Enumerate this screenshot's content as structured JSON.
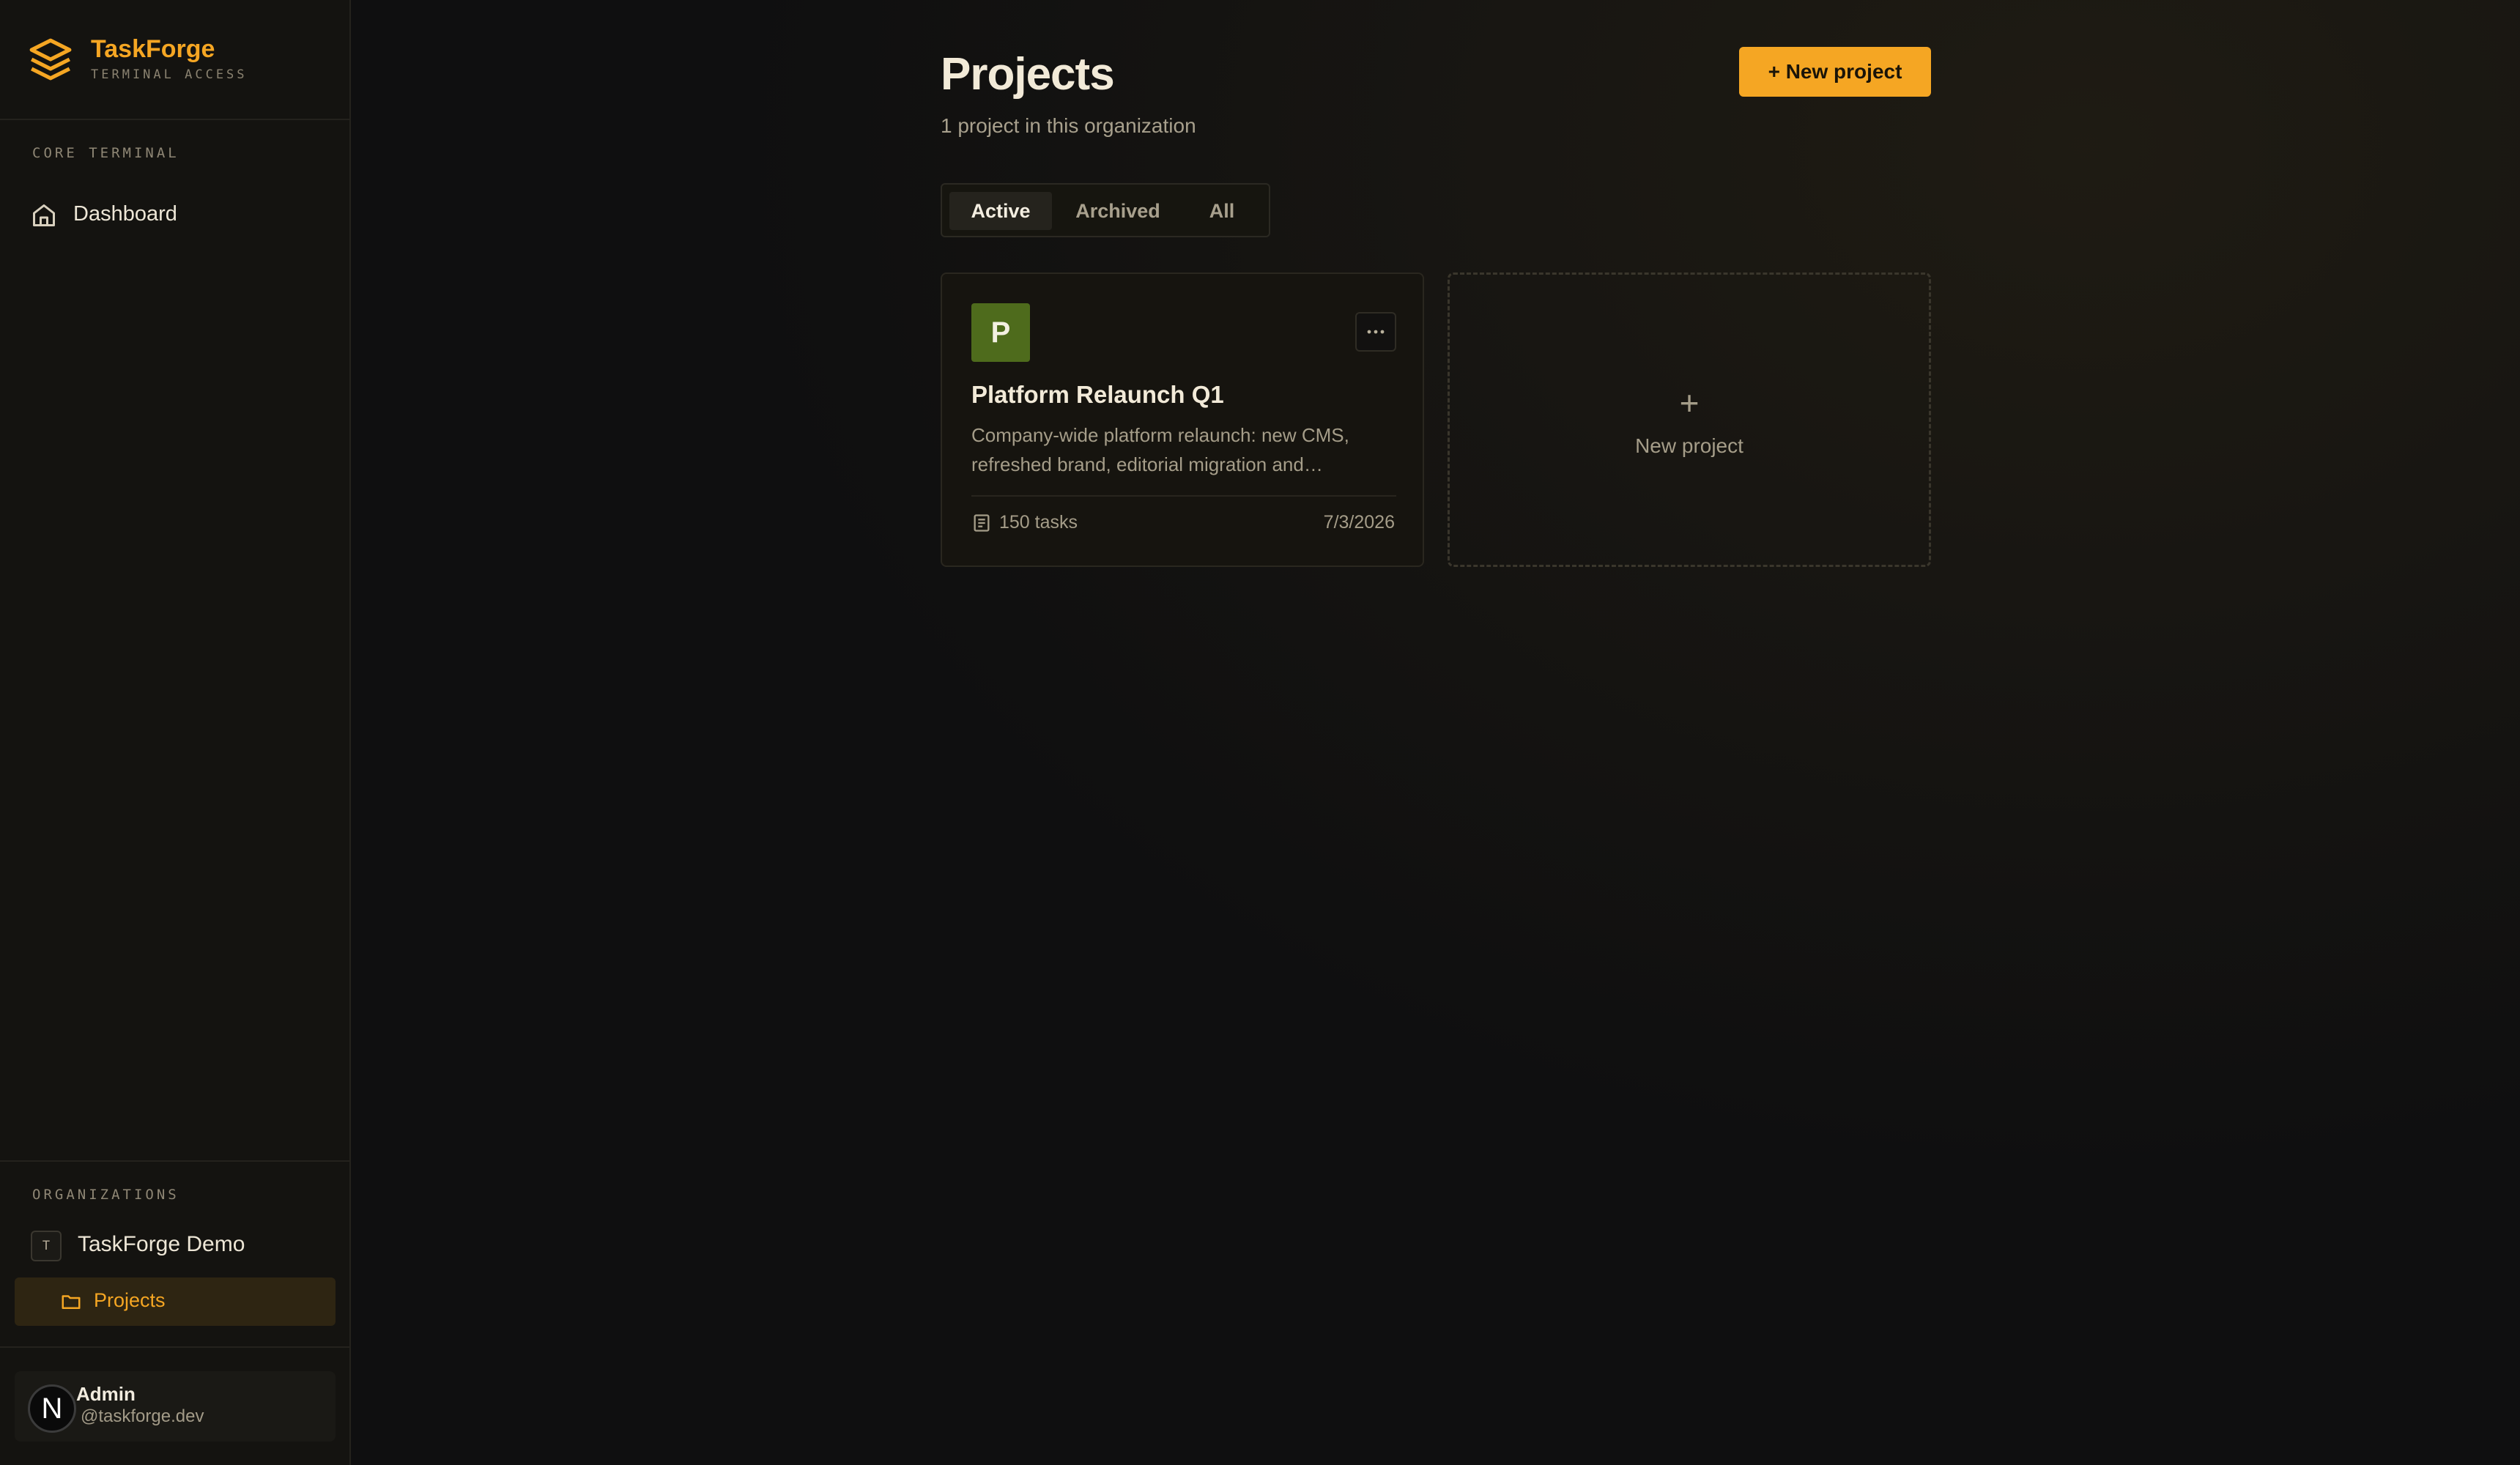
{
  "brand": {
    "name": "TaskForge",
    "subtitle": "TERMINAL ACCESS",
    "logo_icon": "layers-icon",
    "accent_color": "#f5a623"
  },
  "sidebar": {
    "core_section_label": "CORE TERMINAL",
    "nav_items": [
      {
        "label": "Dashboard",
        "icon": "home-icon"
      }
    ],
    "organizations_label": "ORGANIZATIONS",
    "organization": {
      "badge": "T",
      "name": "TaskForge Demo"
    },
    "org_items": [
      {
        "label": "Projects",
        "icon": "folder-icon",
        "active": true
      }
    ],
    "user": {
      "name": "Admin",
      "email": "@taskforge.dev",
      "avatar_letter": "N"
    }
  },
  "main": {
    "title": "Projects",
    "subtitle": "1 project in this organization",
    "new_project_button": "+ New project",
    "tabs": [
      {
        "label": "Active",
        "active": true
      },
      {
        "label": "Archived",
        "active": false
      },
      {
        "label": "All",
        "active": false
      }
    ],
    "projects": [
      {
        "avatar_letter": "P",
        "avatar_color": "#4e6b1c",
        "title": "Platform Relaunch Q1",
        "description": "Company-wide platform relaunch: new CMS, refreshed brand, editorial migration and…",
        "tasks": "150 tasks",
        "date": "7/3/2026",
        "more_icon": "more-horizontal-icon"
      }
    ],
    "new_project_card": {
      "plus": "+",
      "label": "New project"
    }
  }
}
